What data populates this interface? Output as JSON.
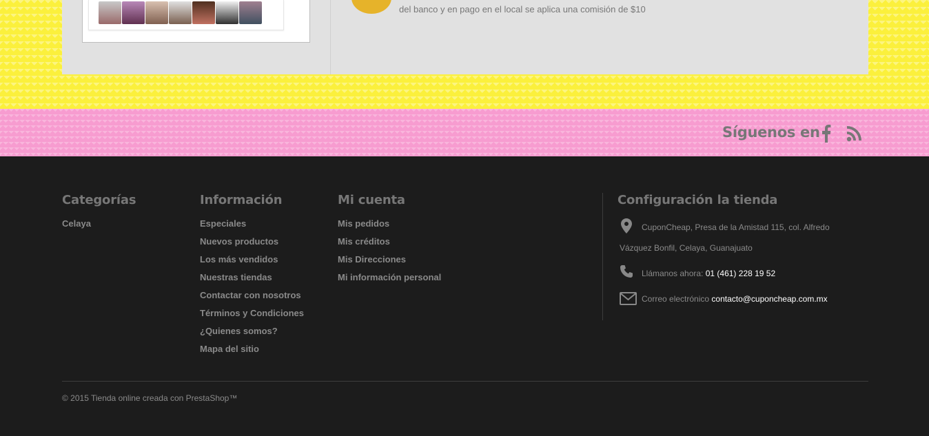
{
  "banner": {
    "payment_note": "del banco y en pago en el local se aplica una comisión de $10"
  },
  "social": {
    "follow_label": "Síguenos en",
    "icons": [
      "facebook-icon",
      "rss-icon"
    ]
  },
  "footer": {
    "categories": {
      "title": "Categorías",
      "items": [
        "Celaya"
      ]
    },
    "information": {
      "title": "Información",
      "items": [
        "Especiales",
        "Nuevos productos",
        "Los más vendidos",
        "Nuestras tiendas",
        "Contactar con nosotros",
        "Términos y Condiciones",
        "¿Quienes somos?",
        "Mapa del sitio"
      ]
    },
    "account": {
      "title": "Mi cuenta",
      "items": [
        "Mis pedidos",
        "Mis créditos",
        "Mis Direcciones",
        "Mi información personal"
      ]
    },
    "store": {
      "title": "Configuración la tienda",
      "address_line1": "CuponCheap, Presa de la Amistad 115, col. Alfredo",
      "address_line2": "Vázquez Bonfil, Celaya, Guanajuato",
      "phone_label": "Llámanos ahora:",
      "phone": "01 (461) 228 19 52",
      "email_label": "Correo electrónico",
      "email": "contacto@cuponcheap.com.mx"
    },
    "copyright": "© 2015 Tienda online creada con PrestaShop™"
  },
  "colors": {
    "yellow_band": "#fbf03c",
    "pink_band": "#f79cd0",
    "footer_bg": "#1c1c1c",
    "panel_bg": "#e1e1e1",
    "accent_badge": "#e6b32a"
  }
}
